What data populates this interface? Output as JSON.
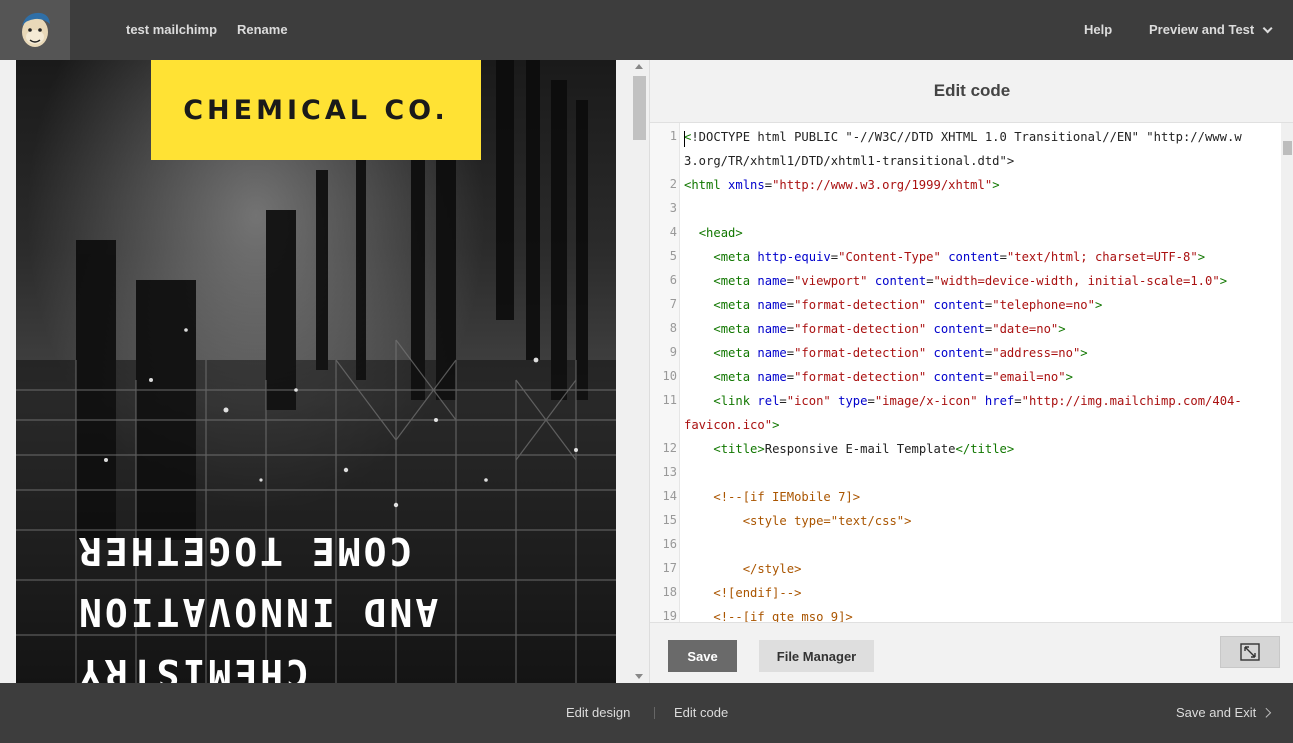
{
  "topbar": {
    "campaign_name": "test mailchimp",
    "rename": "Rename",
    "help": "Help",
    "preview_and_test": "Preview and Test"
  },
  "preview": {
    "brand": "CHEMICAL CO.",
    "headline": "CHEMISTRY\nAND INNOVATION\nCOME TOGETHER"
  },
  "code_panel": {
    "title": "Edit code",
    "line_numbers": [
      "1",
      "2",
      "3",
      "4",
      "5",
      "6",
      "7",
      "8",
      "9",
      "10",
      "11",
      "12",
      "13",
      "14",
      "15",
      "16",
      "17",
      "18",
      "19"
    ],
    "save": "Save",
    "file_manager": "File Manager"
  },
  "bottombar": {
    "edit_design": "Edit design",
    "edit_code": "Edit code",
    "save_and_exit": "Save and Exit"
  }
}
